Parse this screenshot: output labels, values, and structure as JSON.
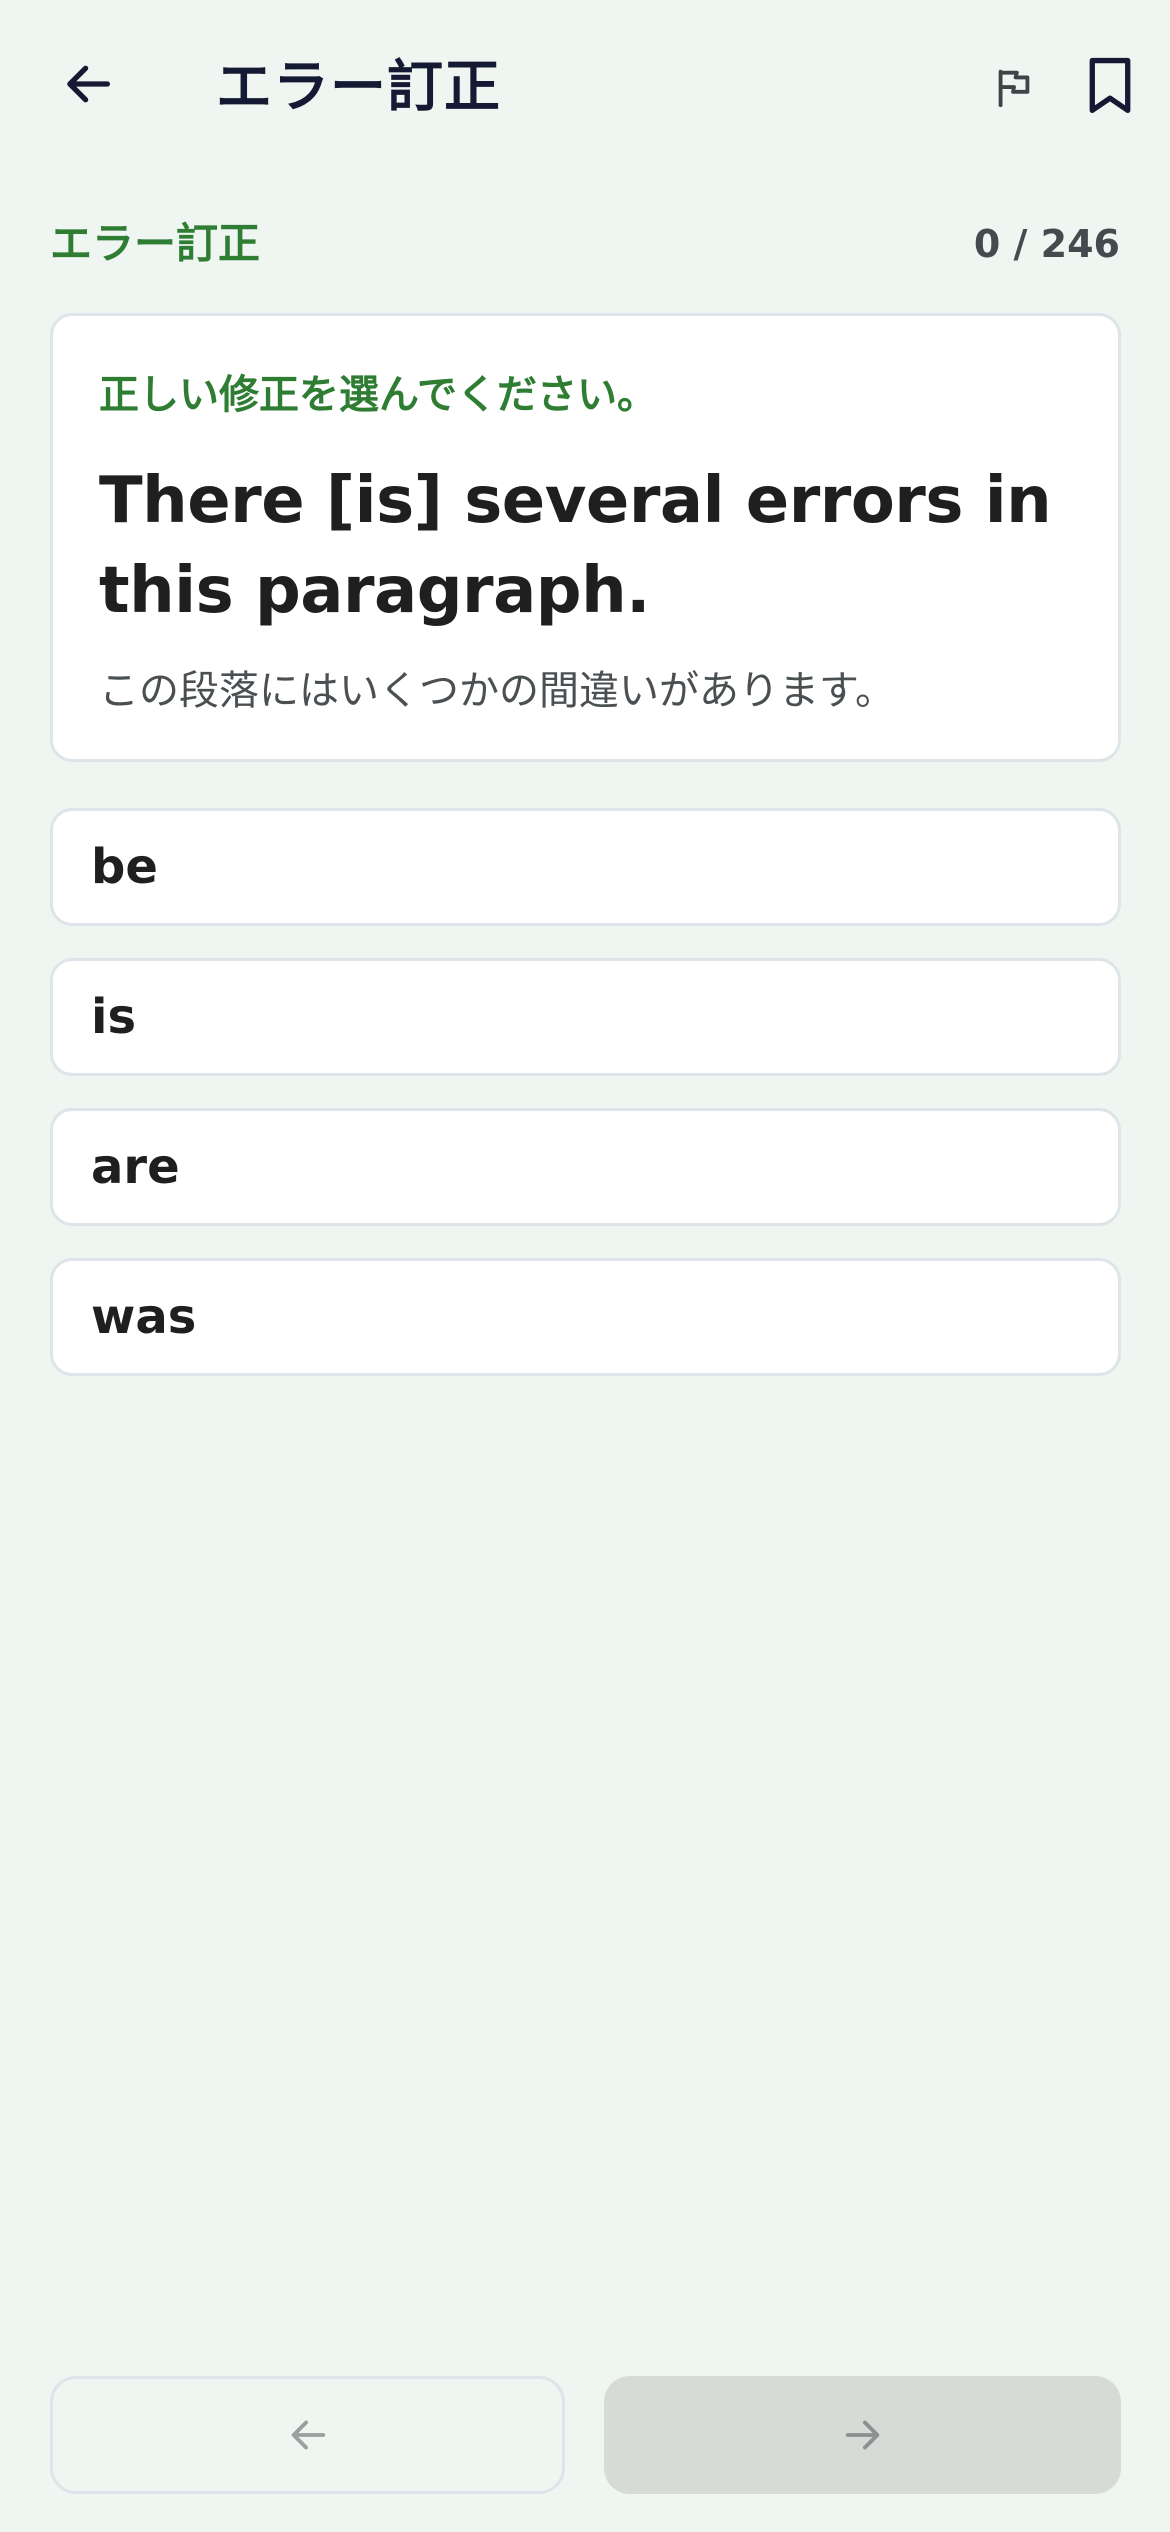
{
  "header": {
    "title": "エラー訂正",
    "back_icon": "arrow-left-icon",
    "flag_icon": "flag-icon",
    "bookmark_icon": "bookmark-icon"
  },
  "section": {
    "label": "エラー訂正",
    "progress": "0 / 246"
  },
  "question": {
    "instruction": "正しい修正を選んでください。",
    "sentence": "There [is] several errors in this paragraph.",
    "translation": "この段落にはいくつかの間違いがあります。"
  },
  "options": [
    {
      "label": "be"
    },
    {
      "label": "is"
    },
    {
      "label": "are"
    },
    {
      "label": "was"
    }
  ],
  "nav": {
    "prev_icon": "arrow-left-icon",
    "next_icon": "arrow-right-icon"
  },
  "colors": {
    "accent_green": "#2e7d32",
    "background": "#eff5f1",
    "card_border": "#dde4ea",
    "next_disabled": "#d6dbd8"
  }
}
